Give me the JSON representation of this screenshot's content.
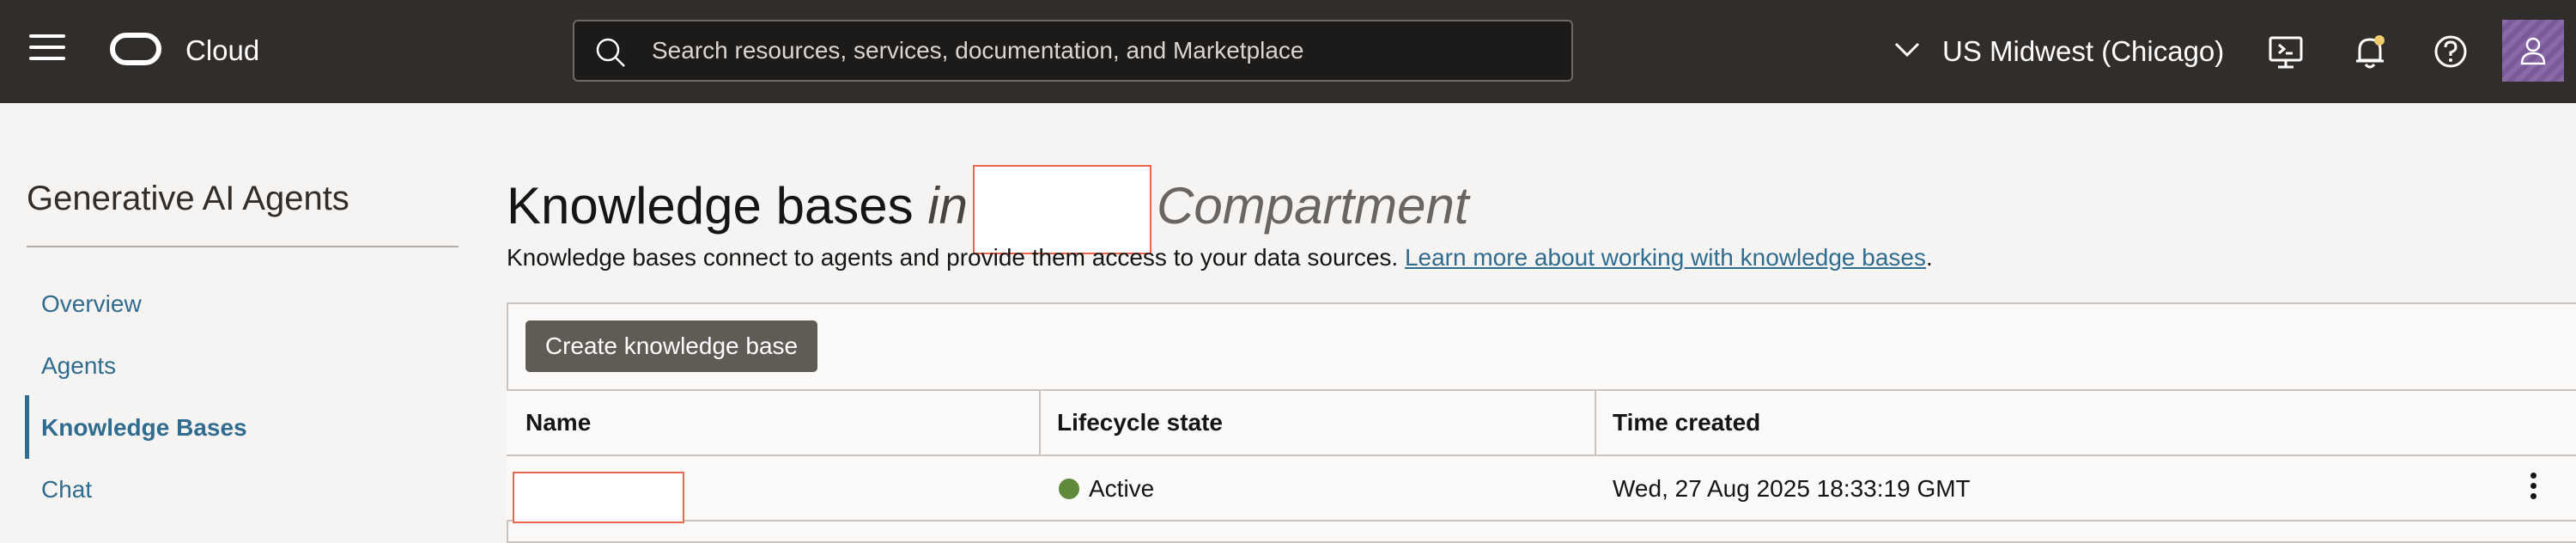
{
  "header": {
    "brand": "Cloud",
    "search_placeholder": "Search resources, services, documentation, and Marketplace",
    "region": "US Midwest (Chicago)"
  },
  "sidebar": {
    "title": "Generative AI Agents",
    "items": [
      {
        "label": "Overview",
        "active": false
      },
      {
        "label": "Agents",
        "active": false
      },
      {
        "label": "Knowledge Bases",
        "active": true
      },
      {
        "label": "Chat",
        "active": false
      }
    ]
  },
  "main": {
    "title_main": "Knowledge bases",
    "title_in": "in",
    "title_compartment": "Compartment",
    "description": "Knowledge bases connect to agents and provide them access to your data sources. ",
    "learn_more": "Learn more about working with knowledge bases",
    "description_end": ".",
    "create_button": "Create knowledge base",
    "columns": [
      "Name",
      "Lifecycle state",
      "Time created"
    ],
    "rows": [
      {
        "name": "",
        "state": "Active",
        "time_created": "Wed, 27 Aug 2025 18:33:19 GMT"
      }
    ]
  },
  "colors": {
    "header_bg": "#312d2a",
    "link": "#2f6c8f",
    "status_active": "#5f8a3b",
    "button_bg": "#615b56",
    "redaction_border": "#e8664f"
  }
}
